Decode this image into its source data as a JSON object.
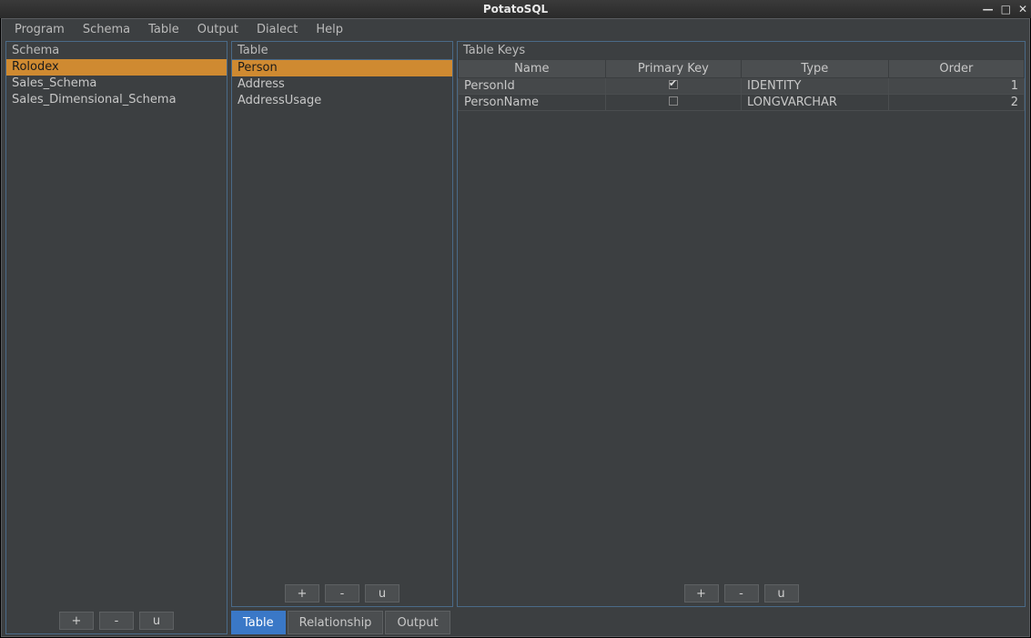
{
  "window": {
    "title": "PotatoSQL"
  },
  "menubar": {
    "items": [
      "Program",
      "Schema",
      "Table",
      "Output",
      "Dialect",
      "Help"
    ]
  },
  "schema_panel": {
    "title": "Schema",
    "items": [
      {
        "label": "Rolodex",
        "selected": true
      },
      {
        "label": "Sales_Schema",
        "selected": false
      },
      {
        "label": "Sales_Dimensional_Schema",
        "selected": false
      }
    ],
    "buttons": {
      "add": "+",
      "remove": "-",
      "update": "u"
    }
  },
  "table_panel": {
    "title": "Table",
    "items": [
      {
        "label": "Person",
        "selected": true
      },
      {
        "label": "Address",
        "selected": false
      },
      {
        "label": "AddressUsage",
        "selected": false
      }
    ],
    "buttons": {
      "add": "+",
      "remove": "-",
      "update": "u"
    }
  },
  "keys_panel": {
    "title": "Table Keys",
    "columns": [
      "Name",
      "Primary Key",
      "Type",
      "Order"
    ],
    "rows": [
      {
        "name": "PersonId",
        "pk": true,
        "type": "IDENTITY",
        "order": "1"
      },
      {
        "name": "PersonName",
        "pk": false,
        "type": "LONGVARCHAR",
        "order": "2"
      }
    ],
    "buttons": {
      "add": "+",
      "remove": "-",
      "update": "u"
    }
  },
  "tabs": {
    "items": [
      {
        "label": "Table",
        "active": true
      },
      {
        "label": "Relationship",
        "active": false
      },
      {
        "label": "Output",
        "active": false
      }
    ]
  }
}
